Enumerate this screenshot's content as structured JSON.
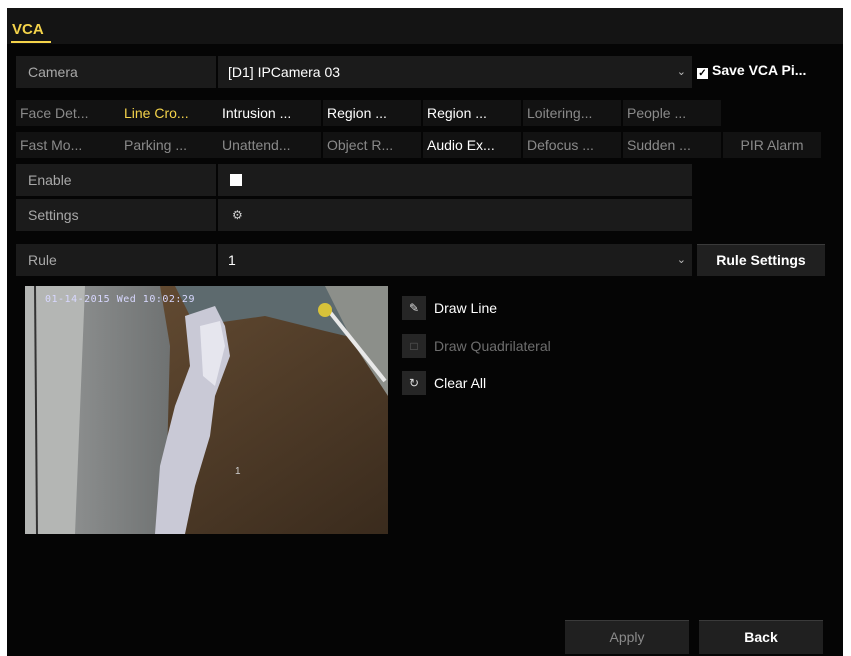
{
  "header": {
    "tab_label": "VCA"
  },
  "camera": {
    "label": "Camera",
    "value": "[D1] IPCamera 03"
  },
  "save_vca": {
    "label": "Save VCA Pi..."
  },
  "tabs_row1": [
    "Face Det...",
    "Line Cro...",
    "Intrusion ...",
    "Region ...",
    "Region ...",
    "Loitering...",
    "People ..."
  ],
  "tabs_row2": [
    "Fast Mo...",
    "Parking ...",
    "Unattend...",
    "Object R...",
    "Audio Ex...",
    "Defocus ...",
    "Sudden ...",
    "PIR Alarm"
  ],
  "enable": {
    "label": "Enable"
  },
  "settings": {
    "label": "Settings"
  },
  "rule": {
    "label": "Rule",
    "value": "1",
    "button": "Rule Settings"
  },
  "preview": {
    "timestamp": "01-14-2015 Wed 10:02:29",
    "camera_number": "1"
  },
  "tools": {
    "draw_line": "Draw Line",
    "draw_quadrilateral": "Draw Quadrilateral",
    "clear_all": "Clear All"
  },
  "footer": {
    "apply": "Apply",
    "back": "Back"
  },
  "colors": {
    "accent": "#f4d34a",
    "background": "#050505",
    "field": "#1b1b1b"
  }
}
